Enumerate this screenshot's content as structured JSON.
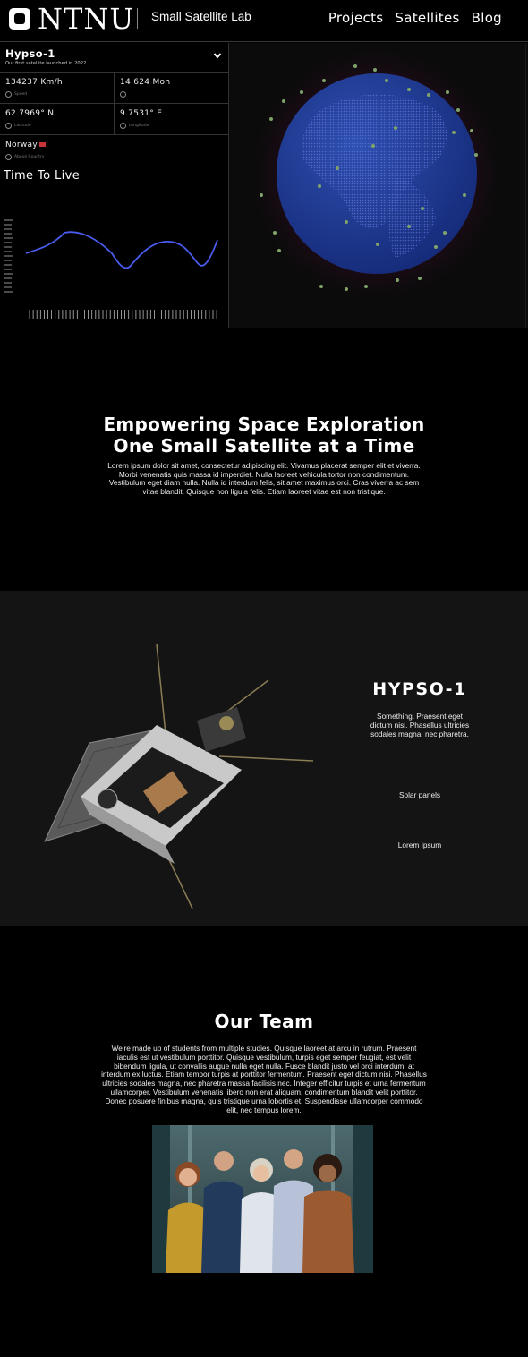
{
  "header": {
    "logo_text": "NTNU",
    "lab_name": "Small Satellite Lab",
    "nav": [
      "Projects",
      "Satellites",
      "Blog"
    ]
  },
  "dashboard": {
    "satellite": {
      "name": "Hypso-1",
      "subtitle": "Our first satellite launched in 2022"
    },
    "stats": {
      "speed": {
        "value": "134237 Km/h",
        "label": "Speed"
      },
      "altitude": {
        "value": "14 624 Moh",
        "label": ""
      },
      "latitude": {
        "value": "62.7969° N",
        "label": "Latitude"
      },
      "longitude": {
        "value": "9.7531° E",
        "label": "Longitude"
      },
      "country": {
        "value": "Norway",
        "label": "Above Country"
      }
    },
    "ttl": {
      "title": "Time To Live",
      "line_color": "#4a5cf0"
    },
    "globe_color": "#1e3a8a"
  },
  "hero": {
    "title_line1": "Empowering Space Exploration",
    "title_line2": "One Small Satellite at a Time",
    "body": "Lorem ipsum dolor sit amet, consectetur adipiscing elit. Vivamus  placerat semper elit et viverra. Morbi venenatis quis massa id  imperdiet. Nulla laoreet vehicula tortor non condimentum. Vestibulum  eget diam nulla. Nulla id interdum felis, sit amet maximus orci. Cras  viverra ac sem vitae blandit. Quisque non ligula felis. Etiam laoreet  vitae est non tristique."
  },
  "hypso": {
    "title": "HYPSO-1",
    "description": "Something. Praesent eget dictum nisi. Phasellus ultricies  sodales magna, nec pharetra.",
    "features": [
      "Solar panels",
      "Lorem Ipsum"
    ]
  },
  "team": {
    "title": "Our Team",
    "body": "We're made up of students from multiple studies. Quisque laoreet at arcu in rutrum. Praesent iaculis est ut vestibulum  porttitor. Quisque vestibulum, turpis eget semper feugiat, est velit bibendum ligula, ut convallis augue nulla eget nulla. Fusce blandit  justo vel orci interdum, at interdum ex luctus. Etiam tempor turpis at  porttitor fermentum. Praesent eget dictum nisi. Phasellus ultricies  sodales magna, nec pharetra massa facilisis nec. Integer efficitur  turpis et urna fermentum ullamcorper. Vestibulum venenatis libero non  erat aliquam, condimentum blandit velit porttitor. Donec posuere finibus  magna, quis tristique urna lobortis et. Suspendisse ullamcorper commodo  elit, nec tempus lorem."
  }
}
